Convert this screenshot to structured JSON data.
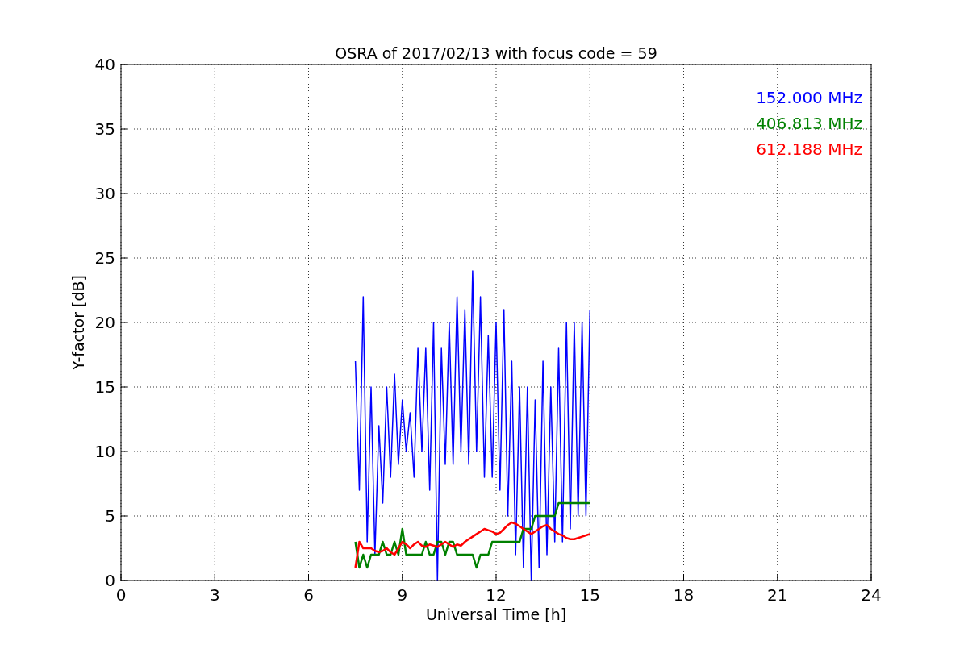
{
  "figure": {
    "chart_data": {
      "type": "line",
      "title": "OSRA of 2017/02/13 with focus code = 59",
      "xlabel": "Universal Time [h]",
      "ylabel": "Y-factor [dB]",
      "x": [
        7.5,
        7.625,
        7.75,
        7.875,
        8,
        8.125,
        8.25,
        8.375,
        8.5,
        8.625,
        8.75,
        8.875,
        9,
        9.125,
        9.25,
        9.375,
        9.5,
        9.625,
        9.75,
        9.875,
        10,
        10.125,
        10.25,
        10.375,
        10.5,
        10.625,
        10.75,
        10.875,
        11,
        11.125,
        11.25,
        11.375,
        11.5,
        11.625,
        11.75,
        11.875,
        12,
        12.125,
        12.25,
        12.375,
        12.5,
        12.625,
        12.75,
        12.875,
        13,
        13.125,
        13.25,
        13.375,
        13.5,
        13.625,
        13.75,
        13.875,
        14,
        14.125,
        14.25,
        14.375,
        14.5,
        14.625,
        14.75,
        14.875,
        15
      ],
      "series": [
        {
          "name": "152.000 MHz",
          "color": "#0000ff",
          "values": [
            17,
            7,
            22,
            3,
            15,
            2,
            12,
            6,
            15,
            8,
            16,
            9,
            14,
            10,
            13,
            8,
            18,
            10,
            18,
            7,
            20,
            0,
            18,
            9,
            20,
            9,
            22,
            10,
            21,
            9,
            24,
            10,
            22,
            8,
            19,
            8,
            20,
            7,
            21,
            5,
            17,
            2,
            15,
            1,
            15,
            0,
            14,
            1,
            17,
            2,
            15,
            3,
            18,
            3,
            20,
            4,
            20,
            5,
            20,
            5,
            21
          ]
        },
        {
          "name": "406.813 MHz",
          "color": "#008000",
          "values": [
            3,
            1,
            2,
            1,
            2,
            2,
            2,
            3,
            2,
            2,
            3,
            2,
            4,
            2,
            2,
            2,
            2,
            2,
            3,
            2,
            2,
            3,
            3,
            2,
            3,
            3,
            2,
            2,
            2,
            2,
            2,
            1,
            2,
            2,
            2,
            3,
            3,
            3,
            3,
            3,
            3,
            3,
            3,
            4,
            4,
            4,
            5,
            5,
            5,
            5,
            5,
            5,
            6,
            6,
            6,
            6,
            6,
            6,
            6,
            6,
            6
          ]
        },
        {
          "name": "612.188 MHz",
          "color": "#ff0000",
          "values": [
            1,
            3,
            2.5,
            2.5,
            2.5,
            2.3,
            2.2,
            2.3,
            2.5,
            2.2,
            2,
            2.5,
            3,
            2.8,
            2.5,
            2.8,
            3,
            2.7,
            2.6,
            2.8,
            2.7,
            2.6,
            2.8,
            3,
            2.8,
            2.6,
            2.8,
            2.7,
            3,
            3.2,
            3.4,
            3.6,
            3.8,
            4,
            3.9,
            3.8,
            3.6,
            3.7,
            4,
            4.3,
            4.5,
            4.4,
            4.2,
            4,
            3.8,
            3.6,
            3.8,
            4,
            4.2,
            4.3,
            4,
            3.8,
            3.6,
            3.5,
            3.3,
            3.2,
            3.2,
            3.3,
            3.4,
            3.5,
            3.6
          ]
        }
      ],
      "xlim": [
        0,
        24
      ],
      "ylim": [
        0,
        40
      ],
      "xticks": [
        0,
        3,
        6,
        9,
        12,
        15,
        18,
        21,
        24
      ],
      "yticks": [
        0,
        5,
        10,
        15,
        20,
        25,
        30,
        35,
        40
      ],
      "grid": true
    }
  }
}
